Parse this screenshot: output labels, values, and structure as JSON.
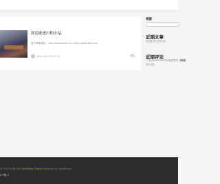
{
  "post": {
    "title": "欢迎走进川的小站",
    "excerpt": "官方博客地址：http://www.qqcc.cn/ http://www.qqcq.cn",
    "meta": "adminluo  2020-1-01",
    "views": "6"
  },
  "sidebar": {
    "search_label": "搜索",
    "recent_posts_title": "近期文章",
    "recent_post_item": "欢迎走进川的小站",
    "recent_comments_title": "近期评论",
    "recent_comment_author": "一位WordPress评论者",
    "recent_comment_on": "发表在",
    "recent_comment_post": "《欢迎",
    "recent_comment_post2": "的小站》"
  },
  "footer": {
    "copyright": "© 2023 川的小站",
    "theme_label": "CorePress Theme",
    "powered": "Powered by WordPress",
    "icp": "ICP备-2"
  },
  "colors": {
    "accent": "#c9a23a",
    "footer_bg": "#2b2c2e"
  }
}
